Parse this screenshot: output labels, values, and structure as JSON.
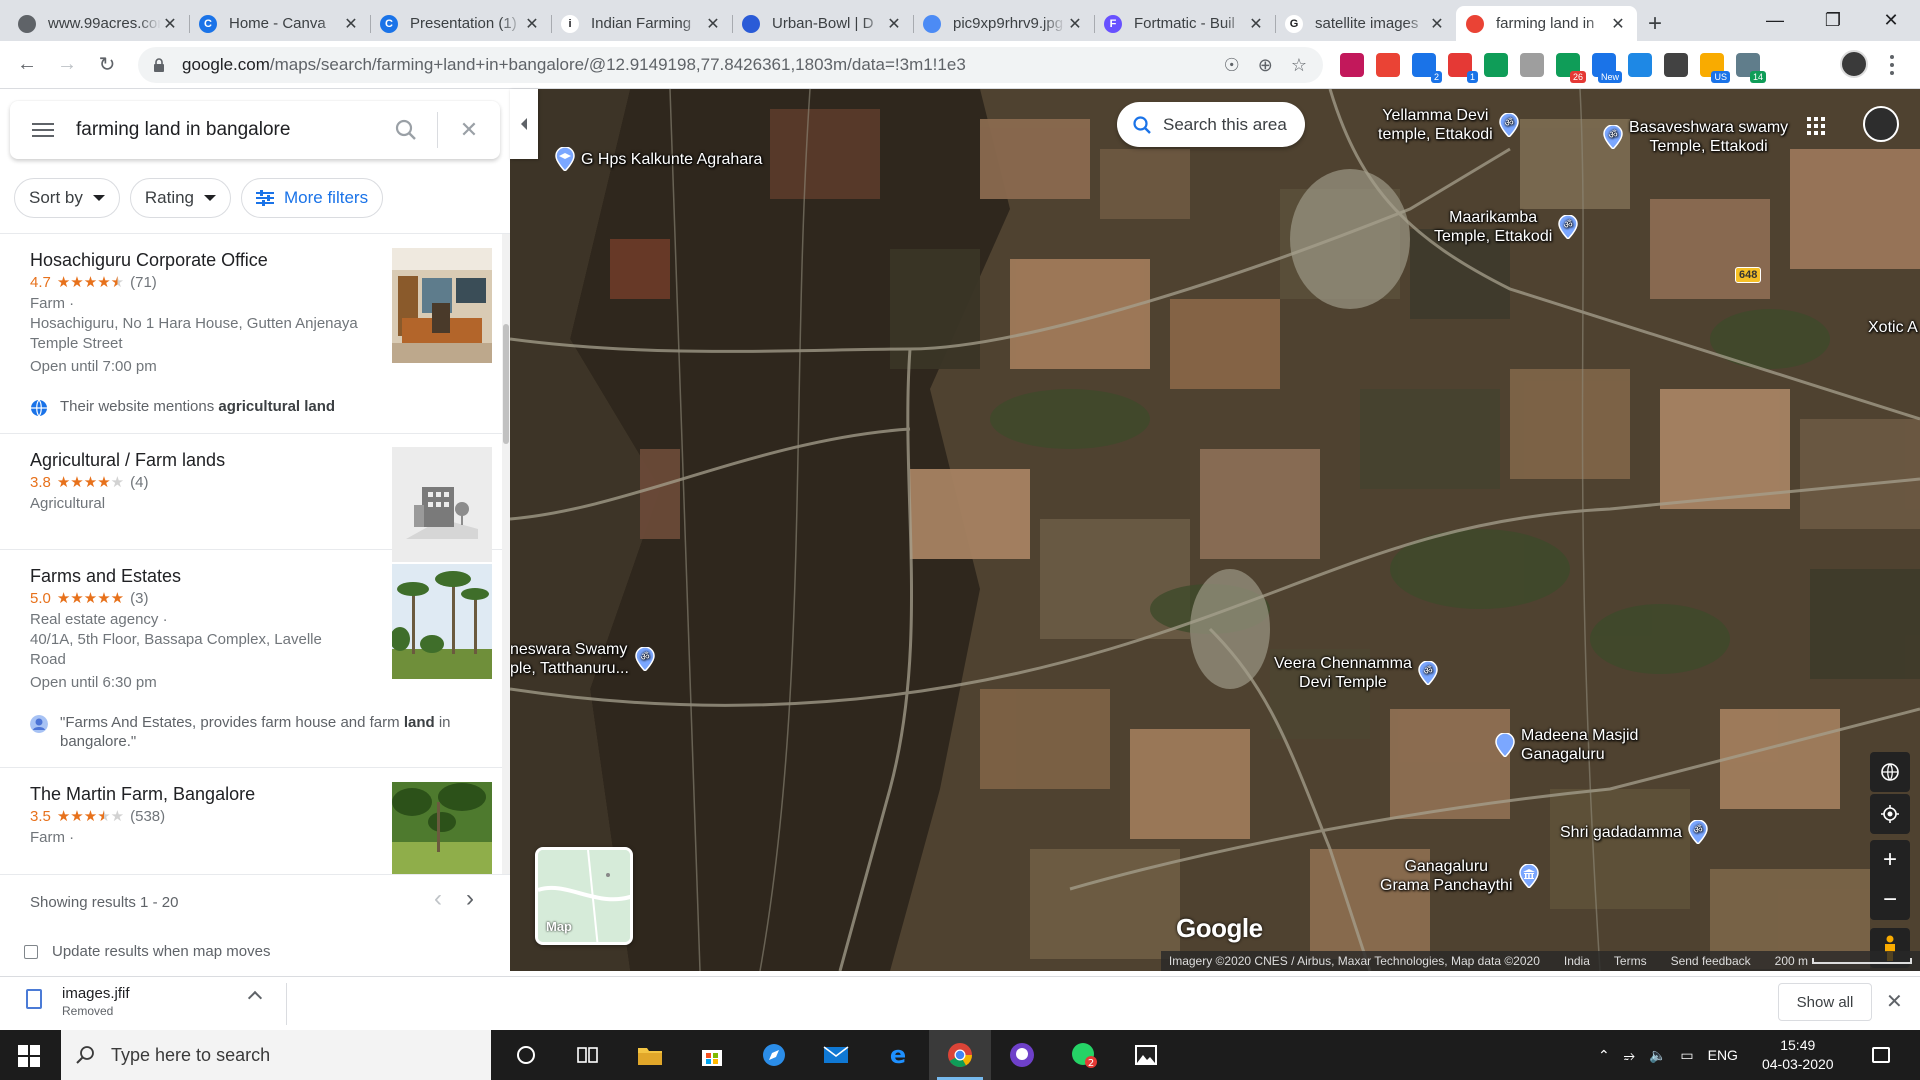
{
  "browser": {
    "tabs": [
      {
        "title": "www.99acres.com",
        "color": "#5f6368",
        "letter": ""
      },
      {
        "title": "Home - Canva",
        "color": "#1a73e8",
        "letter": "C"
      },
      {
        "title": "Presentation (1)",
        "color": "#1a73e8",
        "letter": "C"
      },
      {
        "title": "Indian Farming",
        "color": "#ffffff",
        "letter": "i"
      },
      {
        "title": "Urban-Bowl | D",
        "color": "#2a5bd7",
        "letter": ""
      },
      {
        "title": "pic9xp9rhrv9.jpg",
        "color": "#4c8bf5",
        "letter": ""
      },
      {
        "title": "Fortmatic - Buil",
        "color": "#6851ff",
        "letter": "F"
      },
      {
        "title": "satellite images",
        "color": "#ffffff",
        "letter": "G"
      },
      {
        "title": "farming land in",
        "color": "#ea4335",
        "letter": ""
      }
    ],
    "active_tab_index": 8,
    "url_domain": "google.com",
    "url_rest": "/maps/search/farming+land+in+bangalore/@12.9149198,77.8426361,1803m/data=!3m1!1e3",
    "extension_badges": [
      "2",
      "1",
      "26",
      "New",
      "US",
      "14"
    ]
  },
  "search": {
    "query": "farming land in bangalore"
  },
  "filters": {
    "sort": "Sort by",
    "rating": "Rating",
    "more": "More filters"
  },
  "results": [
    {
      "name": "Hosachiguru Corporate Office",
      "rating": "4.7",
      "stars": 4.5,
      "reviews": "(71)",
      "category": "Farm ·",
      "address": "Hosachiguru, No 1 Hara House, Gutten Anjenaya Temple Street",
      "hours": "Open until 7:00 pm",
      "snippet_pre": "Their website mentions ",
      "snippet_bold": "agricultural land",
      "snippet_post": ""
    },
    {
      "name": "Agricultural / Farm lands",
      "rating": "3.8",
      "stars": 4,
      "reviews": "(4)",
      "category": "Agricultural",
      "address": "",
      "hours": ""
    },
    {
      "name": "Farms and Estates",
      "rating": "5.0",
      "stars": 5,
      "reviews": "(3)",
      "category": "Real estate agency ·",
      "address": "40/1A, 5th Floor, Bassapa Complex, Lavelle Road",
      "hours": "Open until 6:30 pm",
      "snippet_pre": "\"Farms And Estates, provides farm house and farm ",
      "snippet_bold": "land",
      "snippet_post": " in bangalore.\""
    },
    {
      "name": "The Martin Farm, Bangalore",
      "rating": "3.5",
      "stars": 3.5,
      "reviews": "(538)",
      "category": "Farm ·",
      "address": "",
      "hours": ""
    }
  ],
  "footer": {
    "showing": "Showing results 1 - 20",
    "update_label": "Update results when map moves"
  },
  "map": {
    "search_area": "Search this area",
    "places": {
      "p1": "G Hps Kalkunte Agrahara",
      "p2a": "Yellamma Devi",
      "p2b": "temple, Ettakodi",
      "p3a": "Basaveshwara swamy",
      "p3b": "Temple, Ettakodi",
      "p4a": "Maarikamba",
      "p4b": "Temple, Ettakodi",
      "p5": "Xotic A",
      "p6a": "neswara Swamy",
      "p6b": "ple, Tatthanuru...",
      "p7a": "Veera Chennamma",
      "p7b": "Devi Temple",
      "p8a": "Madeena Masjid",
      "p8b": "Ganagaluru",
      "p9": "Shri gadadamma",
      "p10a": "Ganagaluru",
      "p10b": "Grama Panchaythi"
    },
    "route_badge": "648",
    "mini_map_label": "Map",
    "google_logo": "Google",
    "attribution": "Imagery ©2020 CNES / Airbus, Maxar Technologies, Map data ©2020",
    "country": "India",
    "terms": "Terms",
    "feedback": "Send feedback",
    "scale": "200 m"
  },
  "downloads": {
    "file": "images.jfif",
    "status": "Removed",
    "show_all": "Show all"
  },
  "taskbar": {
    "search_placeholder": "Type here to search",
    "lang": "ENG",
    "time": "15:49",
    "date": "04-03-2020",
    "chrome_active": true,
    "whatsapp_badge": "2"
  }
}
